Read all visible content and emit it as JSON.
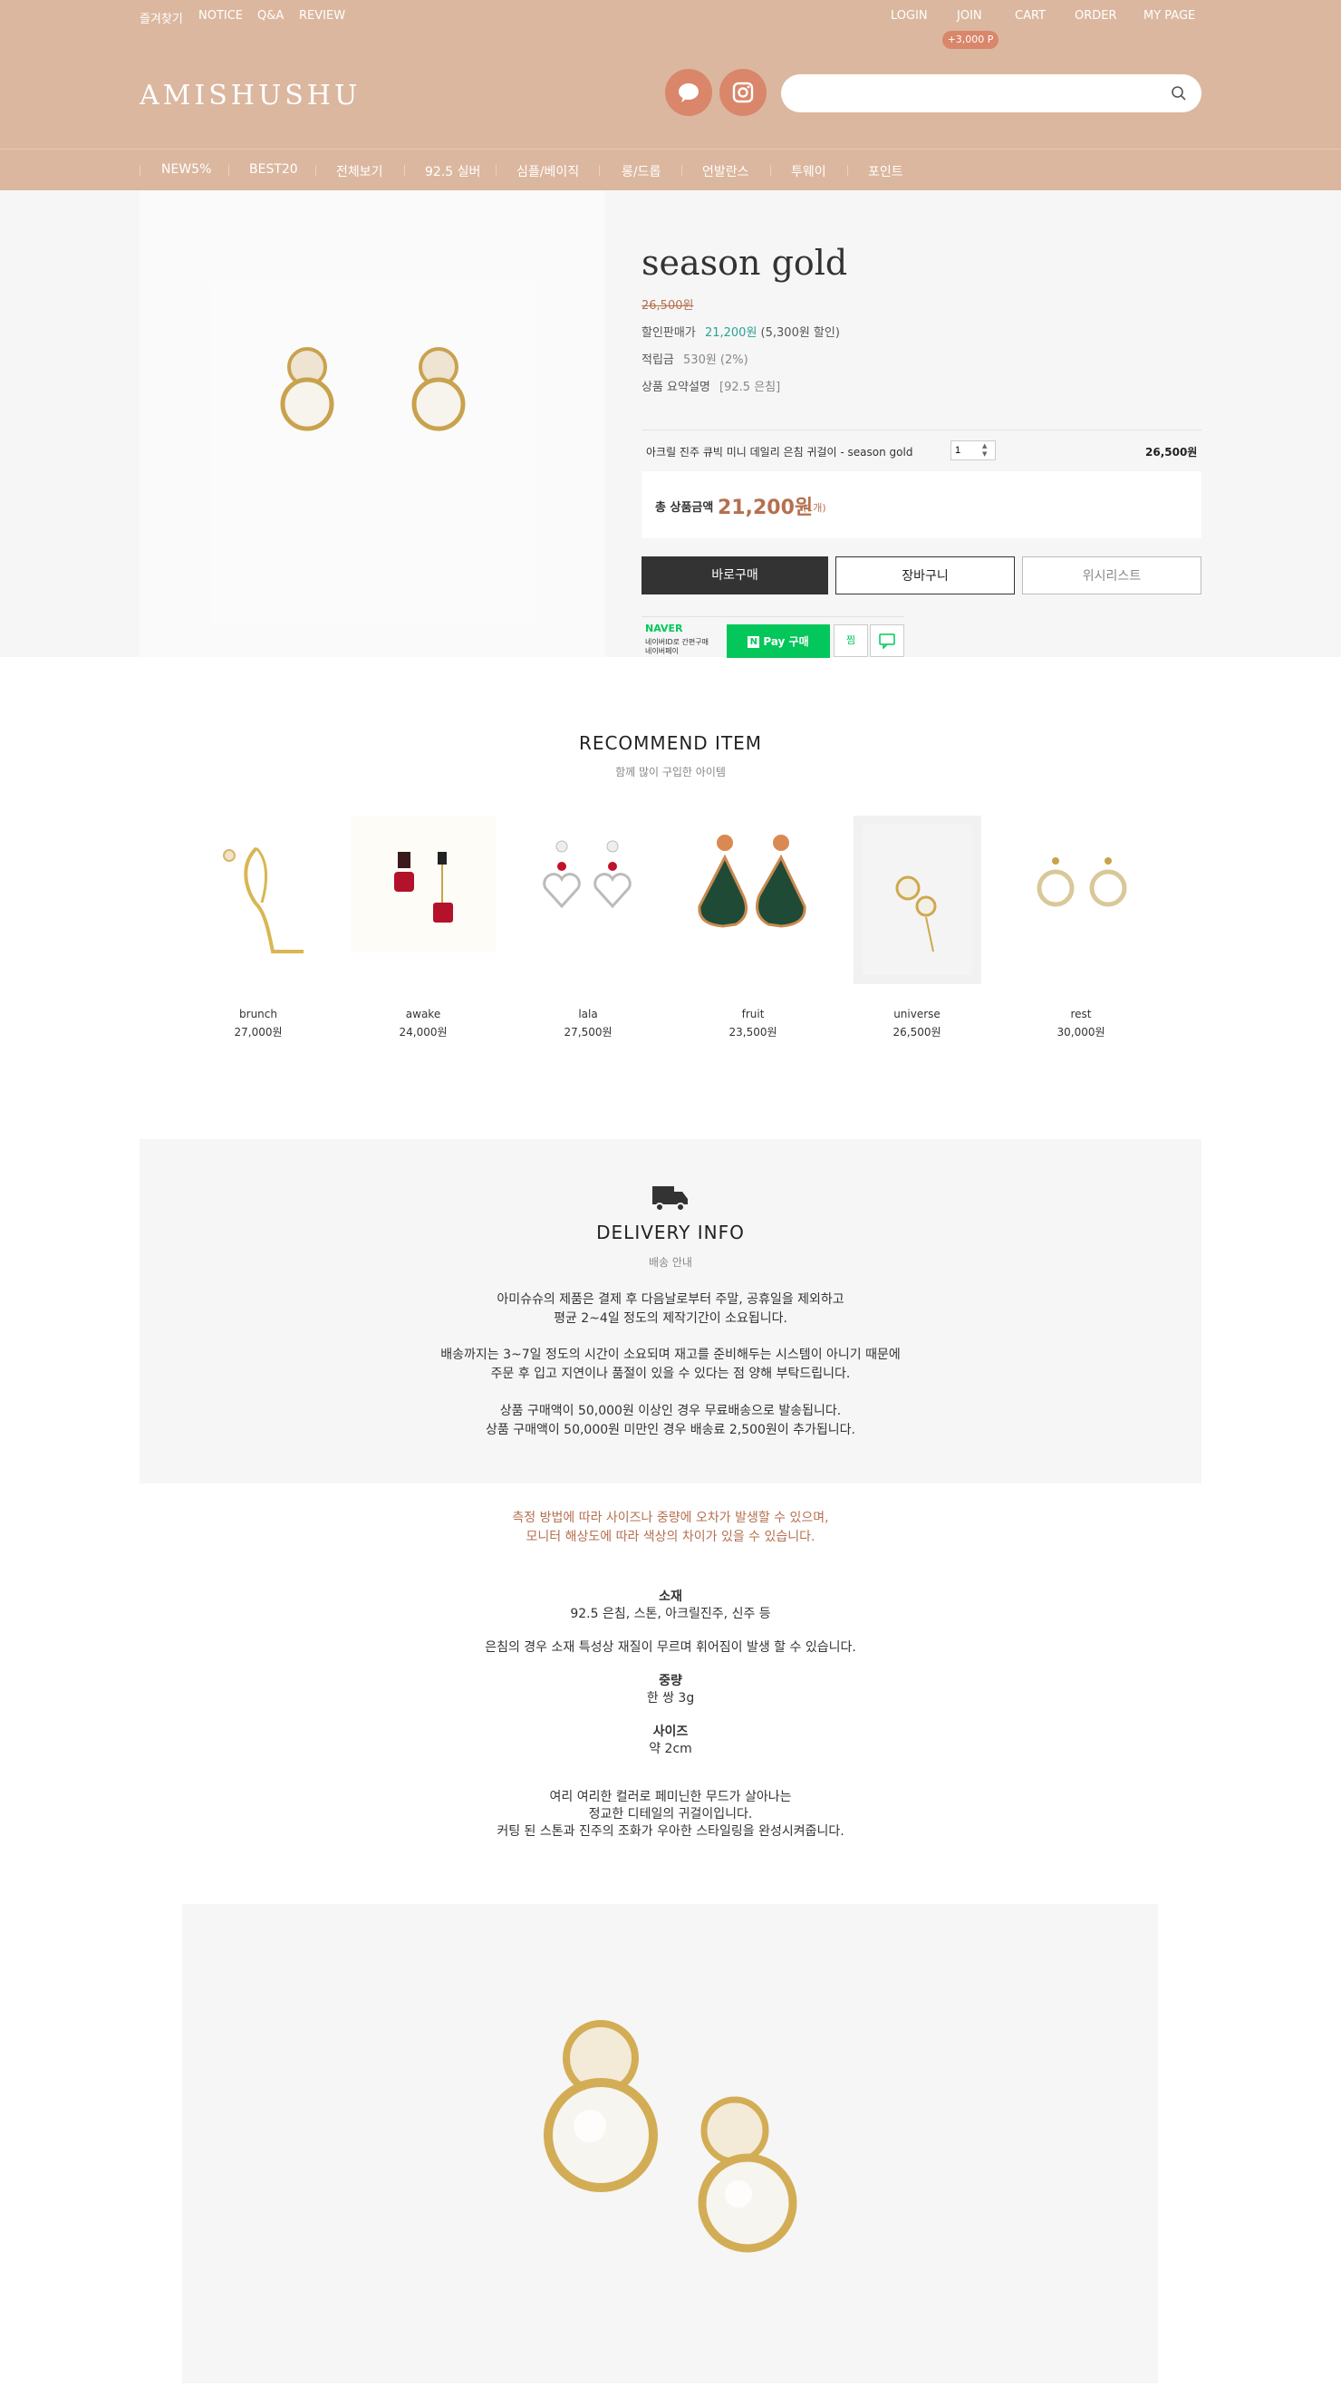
{
  "topbar": {
    "left_links": [
      "즐겨찾기",
      "NOTICE",
      "Q&A",
      "REVIEW"
    ],
    "right_links": [
      "LOGIN",
      "JOIN",
      "CART",
      "ORDER",
      "MY PAGE"
    ],
    "join_badge": "+3,000 P"
  },
  "header": {
    "logo": "AMISHUSHU",
    "search_placeholder": ""
  },
  "nav": [
    "NEW5%",
    "BEST20",
    "전체보기",
    "92.5 실버",
    "심플/베이직",
    "롱/드롭",
    "언발란스",
    "투웨이",
    "포인트"
  ],
  "product": {
    "title": "season gold",
    "original_price": "26,500원",
    "sale_label": "할인판매가",
    "sale_price": "21,200원",
    "sale_note": "(5,300원 할인)",
    "points_label": "적립금",
    "points_value": "530원 (2%)",
    "summary_label": "상품 요약설명",
    "summary_value": "[92.5 은침]",
    "option_name": "아크릴 진주 큐빅 미니 데일리 은침 귀걸이 - season gold",
    "quantity": "1",
    "option_price": "26,500원",
    "total_label": "총 상품금액",
    "total_price": "21,200원",
    "total_count": "(1개)",
    "buy_label": "바로구매",
    "cart_label": "장바구니",
    "wish_label": "위시리스트",
    "naver_logo": "NAVER",
    "naver_sub1": "네이버ID로 간편구매",
    "naver_sub2": "네이버페이",
    "npay_label": "Pay 구매",
    "npay_n": "N",
    "npay_zzim": "찜"
  },
  "recommend": {
    "title": "RECOMMEND ITEM",
    "subtitle": "함께 많이 구입한 아이템",
    "items": [
      {
        "name": "brunch",
        "price": "27,000원"
      },
      {
        "name": "awake",
        "price": "24,000원"
      },
      {
        "name": "lala",
        "price": "27,500원"
      },
      {
        "name": "fruit",
        "price": "23,500원"
      },
      {
        "name": "universe",
        "price": "26,500원"
      },
      {
        "name": "rest",
        "price": "30,000원"
      }
    ]
  },
  "delivery": {
    "title": "DELIVERY INFO",
    "subtitle": "배송 안내",
    "lines": [
      "아미슈슈의 제품은 결제 후 다음날로부터 주말, 공휴일을 제외하고",
      "평균 2~4일 정도의 제작기간이 소요됩니다.",
      "배송까지는 3~7일 정도의 시간이 소요되며 재고를 준비해두는 시스템이 아니기 때문에",
      "주문 후 입고 지연이나 품절이 있을 수 있다는 점 양해 부탁드립니다.",
      "상품 구매액이 50,000원 이상인 경우 무료배송으로 발송됩니다.",
      "상품 구매액이 50,000원 미만인 경우 배송료 2,500원이 추가됩니다."
    ]
  },
  "notice": {
    "line1": "측정 방법에 따라 사이즈나 중량에 오차가 발생할 수 있으며,",
    "line2": "모니터 해상도에 따라 색상의 차이가 있을 수 있습니다.",
    "color": "#b5704f"
  },
  "details": {
    "material_title": "소재",
    "material_value": "92.5 은침, 스톤, 아크릴진주, 신주 등",
    "material_note": "은침의 경우 소재 특성상 재질이 무르며 휘어짐이 발생 할 수 있습니다.",
    "weight_title": "중량",
    "weight_value": "한 쌍 3g",
    "size_title": "사이즈",
    "size_value": "약 2cm",
    "desc1": "여리 여리한 컬러로 페미닌한 무드가 살아나는",
    "desc2": "정교한 디테일의 귀걸이입니다.",
    "desc3": "커팅 된 스톤과 진주의 조화가 우아한 스타일링을 완성시켜줍니다."
  },
  "colors": {
    "header_bg": "#dbb79f",
    "accent": "#b5704f",
    "sale_green": "#2aa198",
    "npay_green": "#03c75a"
  }
}
